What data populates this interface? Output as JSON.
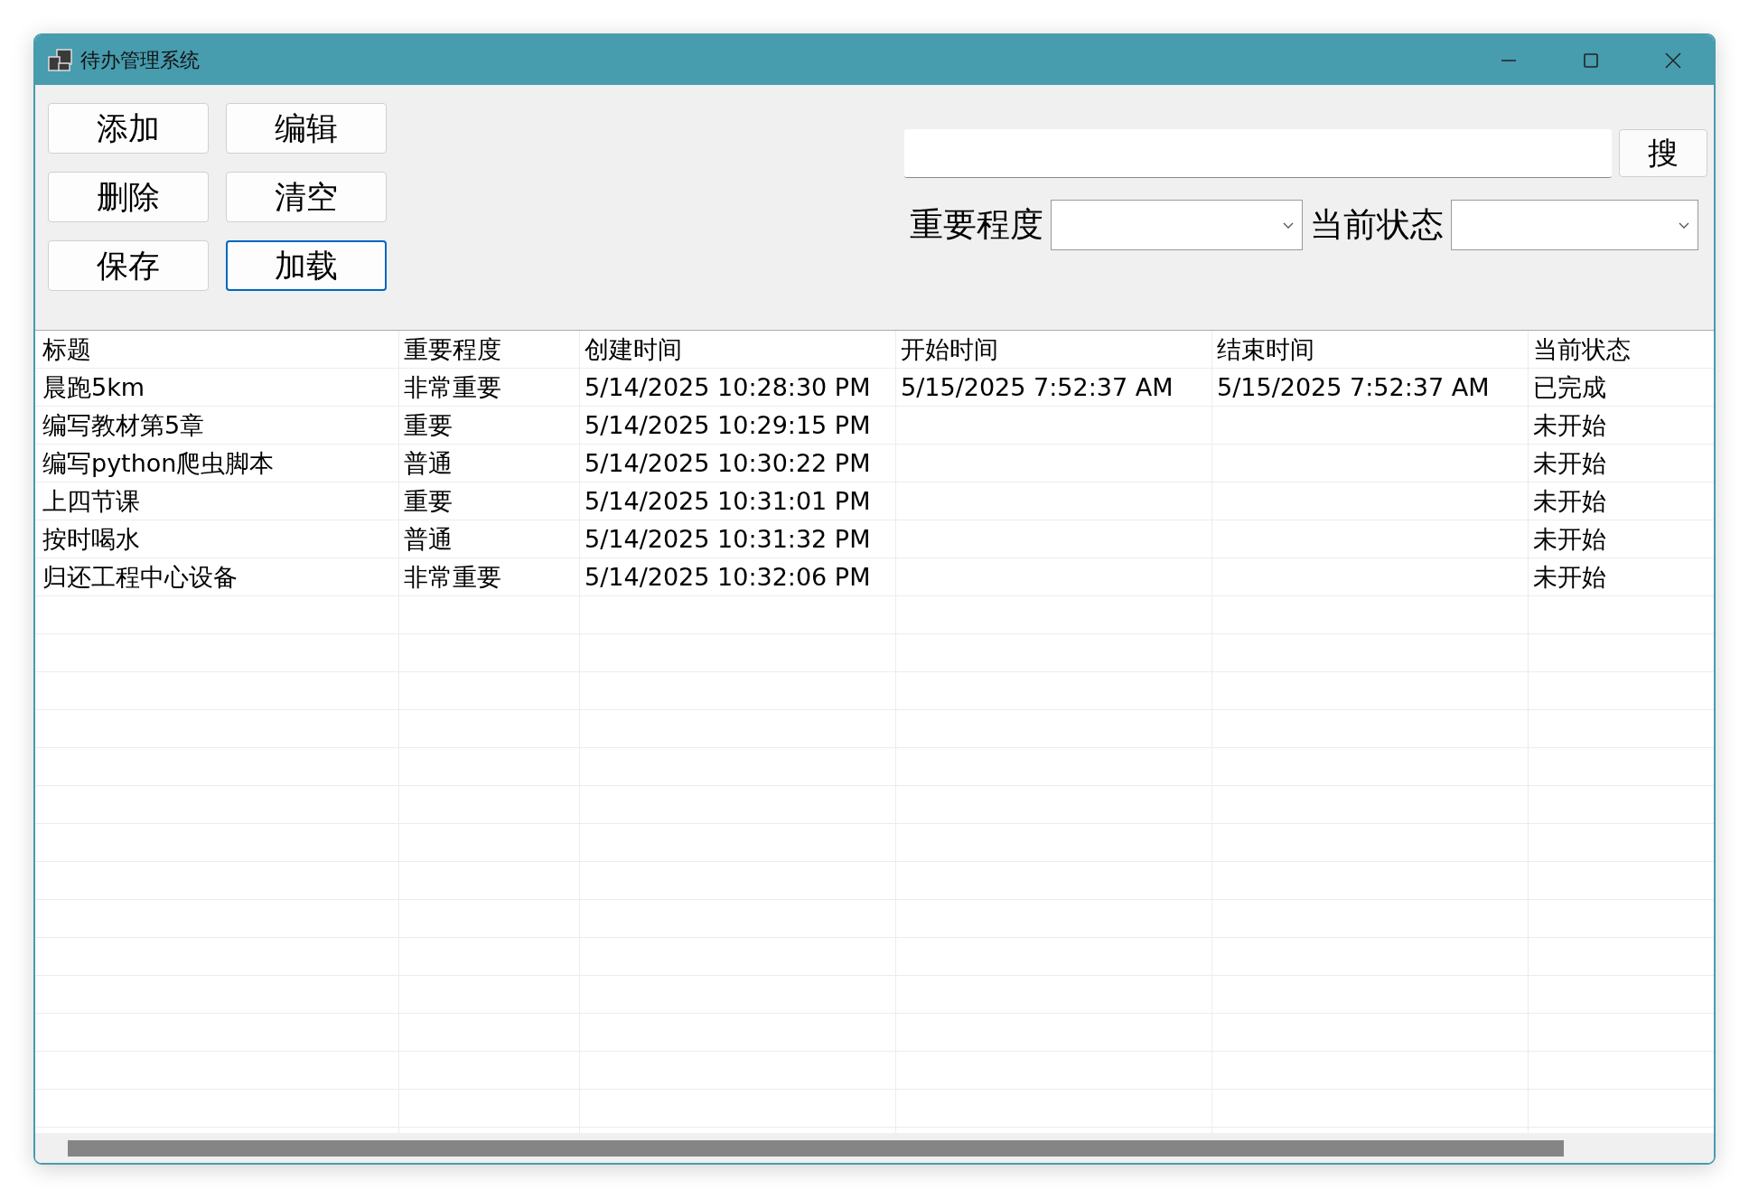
{
  "window": {
    "title": "待办管理系统"
  },
  "buttons": [
    {
      "label": "添加",
      "focused": false
    },
    {
      "label": "编辑",
      "focused": false
    },
    {
      "label": "删除",
      "focused": false
    },
    {
      "label": "清空",
      "focused": false
    },
    {
      "label": "保存",
      "focused": false
    },
    {
      "label": "加载",
      "focused": true
    }
  ],
  "search": {
    "button": "搜"
  },
  "filters": [
    {
      "label": "重要程度"
    },
    {
      "label": "当前状态"
    }
  ],
  "table": {
    "columns": [
      "标题",
      "重要程度",
      "创建时间",
      "开始时间",
      "结束时间",
      "当前状态"
    ],
    "rows": [
      [
        "晨跑5km",
        "非常重要",
        "5/14/2025 10:28:30 PM",
        "5/15/2025 7:52:37 AM",
        "5/15/2025 7:52:37 AM",
        "已完成"
      ],
      [
        "编写教材第5章",
        "重要",
        "5/14/2025 10:29:15 PM",
        "",
        "",
        "未开始"
      ],
      [
        "编写python爬虫脚本",
        "普通",
        "5/14/2025 10:30:22 PM",
        "",
        "",
        "未开始"
      ],
      [
        "上四节课",
        "重要",
        "5/14/2025 10:31:01 PM",
        "",
        "",
        "未开始"
      ],
      [
        "按时喝水",
        "普通",
        "5/14/2025 10:31:32 PM",
        "",
        "",
        "未开始"
      ],
      [
        "归还工程中心设备",
        "非常重要",
        "5/14/2025 10:32:06 PM",
        "",
        "",
        "未开始"
      ]
    ]
  }
}
